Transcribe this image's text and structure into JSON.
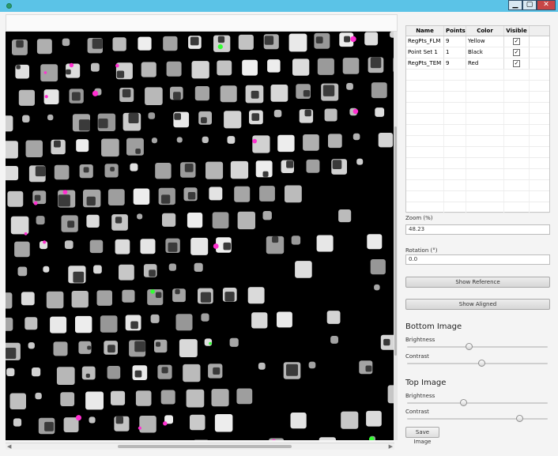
{
  "window": {
    "min_glyph": "▁",
    "max_glyph": "▢",
    "close_glyph": "✕"
  },
  "viewer": {
    "content": "overlay of tiled microscope grid images",
    "background": "#000000"
  },
  "table": {
    "columns": [
      "Name",
      "Points",
      "Color",
      "Visible"
    ],
    "rows": [
      {
        "name": "RegPts_FLM",
        "points": "9",
        "color": "Yellow",
        "visible": "✓"
      },
      {
        "name": "Point Set 1",
        "points": "1",
        "color": "Black",
        "visible": "✓"
      },
      {
        "name": "RegPts_TEM",
        "points": "9",
        "color": "Red",
        "visible": "✓"
      }
    ]
  },
  "zoom": {
    "label": "Zoom (%)",
    "value": "48.23"
  },
  "rotation": {
    "label": "Rotation (°)",
    "value": "0.0"
  },
  "buttons": {
    "show_reference": "Show Reference",
    "show_aligned": "Show Aligned",
    "save_image": "Save Image"
  },
  "bottom_image": {
    "title": "Bottom Image",
    "brightness_label": "Brightness",
    "contrast_label": "Contrast",
    "brightness": 0.44,
    "contrast": 0.53
  },
  "top_image": {
    "title": "Top Image",
    "brightness_label": "Brightness",
    "contrast_label": "Contrast",
    "brightness": 0.4,
    "contrast": 0.8
  },
  "colors": {
    "titlebar": "#5bc3e7",
    "close": "#c74646",
    "magenta_overlay": "#ff2fd0",
    "green_overlay": "#33ff33"
  }
}
